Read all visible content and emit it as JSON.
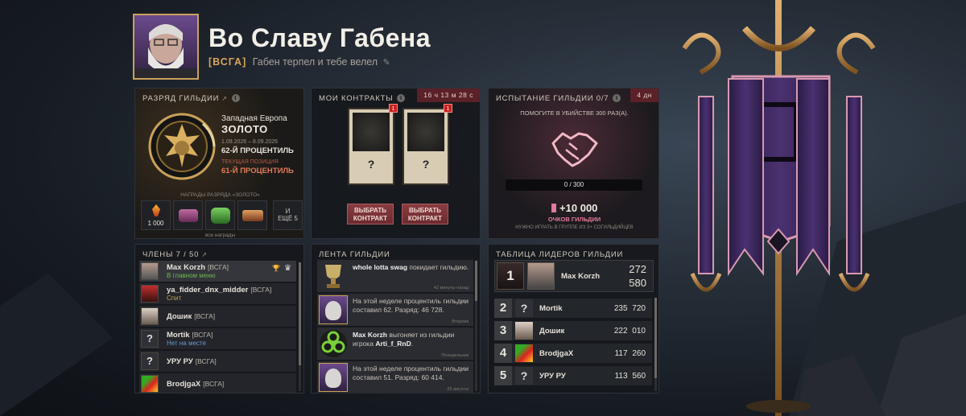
{
  "colors": {
    "accent_red": "#5a2128",
    "gold": "#c6a24b",
    "rank_gold": "#e37b5a",
    "banner_purple": "#3b2759",
    "banner_trim": "#d89ab0"
  },
  "header": {
    "guild_name": "Во Славу Габена",
    "tag": "[ВСГА]",
    "motto": "Габен терпел и тебе велел",
    "edit_icon": "pencil-icon"
  },
  "rank_panel": {
    "title": "Разряд гильдии",
    "region": "Западная Европа",
    "tier": "Золото",
    "period": "1.09.2026 – 8.09.2026",
    "percentile": "62-й процентиль",
    "current_label": "Текущая позиция",
    "current_percentile": "61-й процентиль",
    "rewards_label": "Награды разряда «Золото»",
    "rewards": [
      {
        "icon": "shard-icon",
        "value": "1 000"
      },
      {
        "icon": "chest-icon"
      },
      {
        "icon": "chest-icon"
      },
      {
        "icon": "chest-icon"
      }
    ],
    "more_top": "И",
    "more": "ещё 5",
    "all_rewards": "все награды"
  },
  "contracts_panel": {
    "title": "Мои контракты",
    "timer": "16 ч 13 м 28 с",
    "badge": "1",
    "unknown": "?",
    "select_line1": "Выбрать",
    "select_line2": "контракт"
  },
  "challenge_panel": {
    "title": "Испытание гильдии 0/7",
    "timer": "4 дн",
    "description": "Помогите в убийстве 300 раз(а).",
    "progress": "0 / 300",
    "progress_fraction": 0,
    "points": "+10 000",
    "points_label": "Очков гильдии",
    "note": "Нужно играть в группе из 3+ согильдийцев"
  },
  "members_panel": {
    "title": "Члены 7 / 50",
    "members": [
      {
        "name": "Max Korzh",
        "tag": "[ВСГА]",
        "status": "В главном меню"
      },
      {
        "name": "ya_fidder_dnx_midder",
        "tag": "[ВСГА]",
        "status": "Спит"
      },
      {
        "name": "Дошик",
        "tag": "[ВСГА]",
        "status": ""
      },
      {
        "name": "Mortik",
        "tag": "[ВСГА]",
        "status": "Нет на месте"
      },
      {
        "name": "УРУ РУ",
        "tag": "[ВСГА]",
        "status": ""
      },
      {
        "name": "BrodjgaX",
        "tag": "[ВСГА]",
        "status": ""
      }
    ]
  },
  "feed_panel": {
    "title": "Лента гильдии",
    "items": [
      {
        "actor": "whole lotta swag",
        "text": "покидает гильдию.",
        "date": "42 минуты назад"
      },
      {
        "actor": "",
        "text": "На этой неделе процентиль гильдии составил 62. Разряд: 46 728.",
        "date": "Вторник"
      },
      {
        "actor": "Max Korzh",
        "text": "выгоняет из гильдии игрока",
        "target": "Arti_f_RnD",
        "date": "Понедельник"
      },
      {
        "actor": "",
        "text": "На этой неделе процентиль гильдии составил 51. Разряд: 60 414.",
        "date": "25 августа"
      }
    ]
  },
  "leaderboard_panel": {
    "title": "Таблица лидеров гильдии",
    "top": {
      "rank": "1",
      "name": "Max Korzh",
      "score1": "272",
      "score2": "580"
    },
    "rows": [
      {
        "rank": "2",
        "name": "Mortik",
        "score": "235 720"
      },
      {
        "rank": "3",
        "name": "Дошик",
        "score": "222 010"
      },
      {
        "rank": "4",
        "name": "BrodjgaX",
        "score": "117 260"
      },
      {
        "rank": "5",
        "name": "УРУ РУ",
        "score": "113 560"
      }
    ]
  }
}
